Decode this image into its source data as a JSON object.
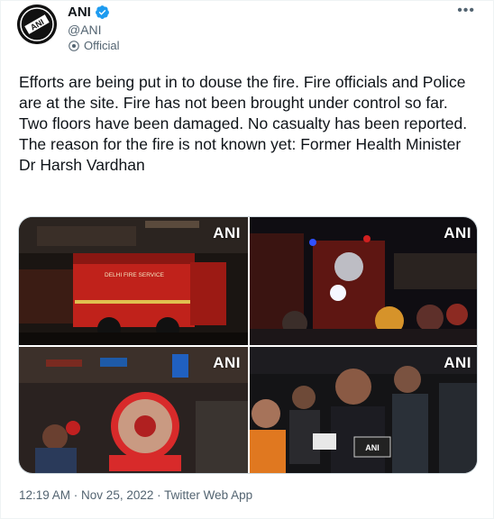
{
  "author": {
    "name": "ANI",
    "handle": "@ANI",
    "official_label": "Official",
    "avatar_icon": "ani-logo-avatar",
    "verified_color": "#1d9bf0"
  },
  "more_menu": "•••",
  "tweet": {
    "text": "Efforts are being put in to douse the fire. Fire officials and Police are at the site. Fire has not been brought under control so far. Two floors have been damaged. No casualty has been reported. The reason for the fire is not known yet: Former Health Minister Dr Harsh Vardhan"
  },
  "media": {
    "watermark": "ANI",
    "photos": [
      {
        "id": "photo-fire-truck",
        "truck_text": "DELHI FIRE SERVICE"
      },
      {
        "id": "photo-night-crowd"
      },
      {
        "id": "photo-smoke-fan"
      },
      {
        "id": "photo-harsh-vardhan",
        "mic_text": "ANI"
      }
    ]
  },
  "meta": {
    "time": "12:19 AM",
    "separator1": " · ",
    "date": "Nov 25, 2022",
    "separator2": " · ",
    "source": "Twitter Web App"
  }
}
